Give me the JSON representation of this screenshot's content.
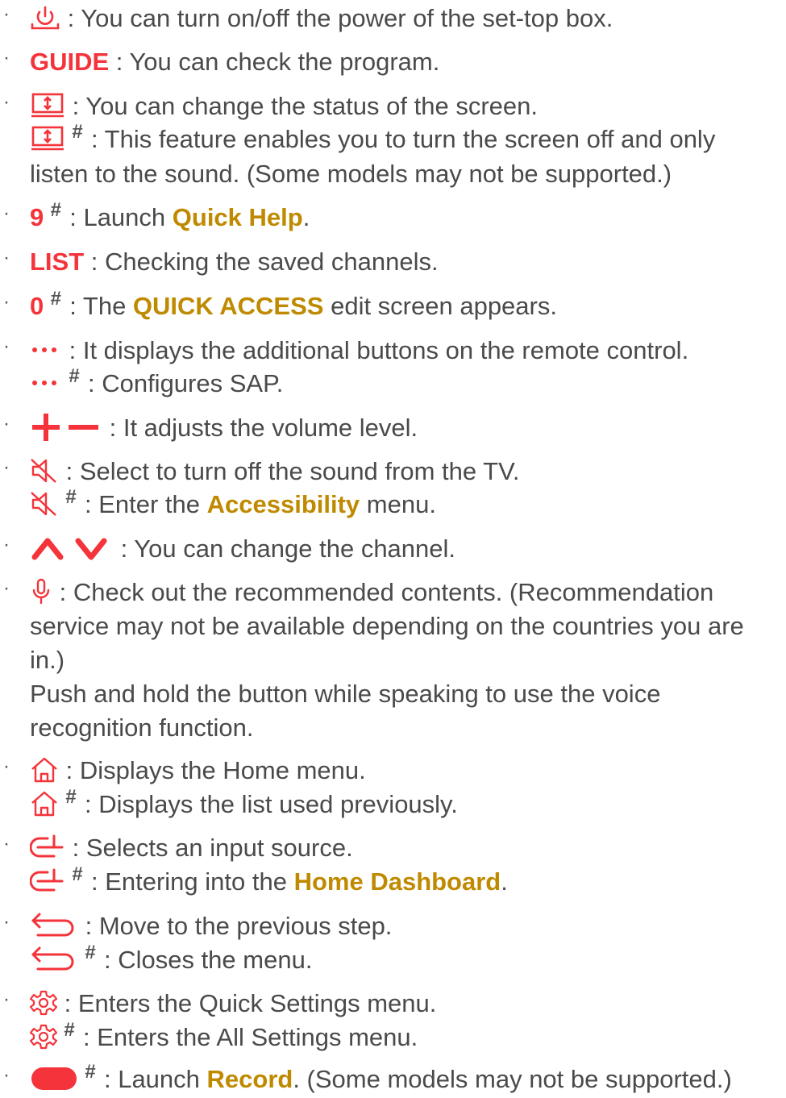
{
  "bullet": "·",
  "hash": "#",
  "accent_red": "#f4333a",
  "accent_gold": "#bf8a00",
  "items": [
    {
      "icon": "power-icon",
      "text": " : You can turn on/off the power of the set-top box."
    },
    {
      "label": "GUIDE",
      "text": " : You can check the program."
    },
    {
      "icon": "screen-status-icon",
      "text": " : You can change the status of the screen.",
      "text2": " : This feature enables you to turn the screen off and only",
      "text3": "listen to the sound. (Some models may not be supported.)"
    },
    {
      "label": "9",
      "pre": " : Launch ",
      "link": "Quick Help",
      "post": "."
    },
    {
      "label": "LIST",
      "text": " : Checking the saved channels."
    },
    {
      "label": "0",
      "pre": " : The ",
      "link": "QUICK ACCESS",
      "post": " edit screen appears."
    },
    {
      "icon": "more-dots-icon",
      "text": " : It displays the additional buttons on the remote control.",
      "text2": " : Configures SAP."
    },
    {
      "icon": "volume-plus-minus-icon",
      "text": " : It adjusts the volume level."
    },
    {
      "icon": "mute-icon",
      "text": " : Select to turn off the sound from the TV.",
      "pre2": " : Enter the ",
      "link2": "Accessibility",
      "post2": " menu."
    },
    {
      "icon": "channel-up-down-icon",
      "text": " : You can change the channel."
    },
    {
      "icon": "microphone-icon",
      "text": " : Check out the recommended contents. (Recommendation",
      "text2": "service may not be available depending on the countries you are",
      "text3": "in.)",
      "text4": "Push and hold the button while speaking to use the voice",
      "text5": "recognition function."
    },
    {
      "icon": "home-icon",
      "text": " : Displays the Home menu.",
      "text2": " : Displays the list used previously."
    },
    {
      "icon": "input-source-icon",
      "text": " : Selects an input source.",
      "pre2": " : Entering into the ",
      "link2": "Home Dashboard",
      "post2": "."
    },
    {
      "icon": "back-icon",
      "text": " : Move to the previous step.",
      "text2": " : Closes the menu."
    },
    {
      "icon": "settings-gear-icon",
      "text": " : Enters the Quick Settings menu.",
      "text2": " : Enters the All Settings menu."
    },
    {
      "icon": "record-button-icon",
      "pre": " : Launch ",
      "link": "Record",
      "post": ". (Some models may not be supported.)"
    }
  ]
}
